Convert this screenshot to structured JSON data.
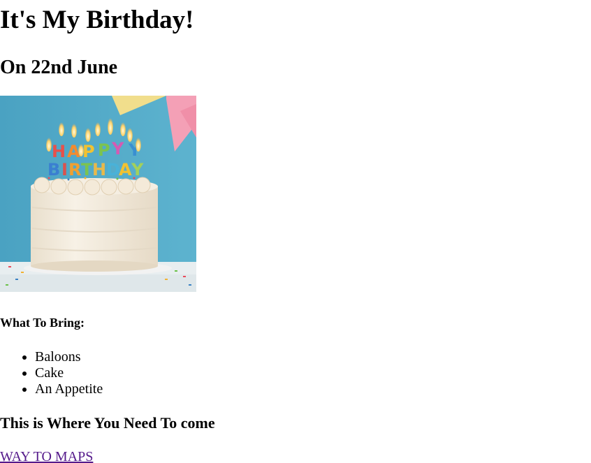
{
  "heading": "It's My Birthday!",
  "date_line": "On 22nd June",
  "image": {
    "subject": "birthday-cake-with-happy-birthday-candles",
    "colors": {
      "background": "#54a9c7",
      "cake": "#f3ece0",
      "flag_yellow": "#f1de8c",
      "flag_pink": "#f4a0b6"
    }
  },
  "bring": {
    "title": "What To Bring:",
    "items": [
      "Baloons",
      "Cake",
      "An Appetite"
    ]
  },
  "where": {
    "title": "This is Where You Need To come",
    "link_text": "WAY TO MAPS",
    "link_color": "#551a8b"
  }
}
